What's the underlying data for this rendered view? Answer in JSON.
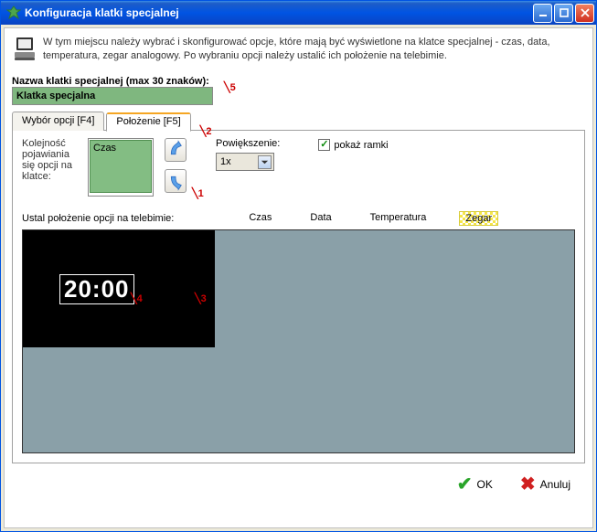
{
  "window": {
    "title": "Konfiguracja klatki specjalnej"
  },
  "description": "W tym miejscu należy wybrać i skonfigurować opcje, które mają być wyświetlone na klatce specjalnej - czas, data, temperatura, zegar analogowy. Po wybraniu opcji należy ustalić ich położenie na telebimie.",
  "name_section": {
    "label": "Nazwa klatki specjalnej (max 30 znaków):",
    "value": "Klatka specjalna"
  },
  "tabs": {
    "options_label": "Wybór opcji [F4]",
    "position_label": "Położenie [F5]"
  },
  "order": {
    "label": "Kolejność pojawiania się opcji na klatce:",
    "items": [
      "Czas"
    ]
  },
  "zoom": {
    "label": "Powiększenie:",
    "value": "1x"
  },
  "frames": {
    "label": "pokaż ramki",
    "checked": true
  },
  "legend": {
    "title": "Ustal położenie opcji na telebimie:",
    "items": [
      "Czas",
      "Data",
      "Temperatura",
      "Zegar"
    ],
    "highlighted": "Zegar"
  },
  "preview": {
    "clock": "20:00"
  },
  "annotations": {
    "a1": "1",
    "a2": "2",
    "a3": "3",
    "a4": "4",
    "a5": "5"
  },
  "footer": {
    "ok": "OK",
    "cancel": "Anuluj"
  }
}
